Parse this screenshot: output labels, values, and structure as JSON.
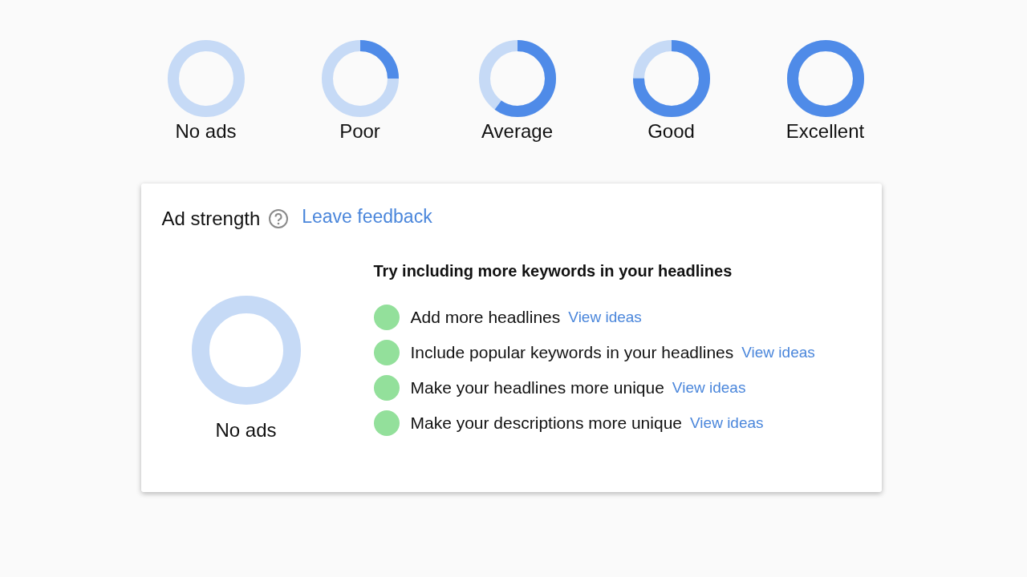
{
  "legend": [
    {
      "label": "No ads",
      "level": 0
    },
    {
      "label": "Poor",
      "level": 0.25
    },
    {
      "label": "Average",
      "level": 0.6
    },
    {
      "label": "Good",
      "level": 0.75
    },
    {
      "label": "Excellent",
      "level": 1
    }
  ],
  "card": {
    "title": "Ad strength",
    "feedback_link": "Leave feedback",
    "gauge": {
      "label": "No ads",
      "level": 0
    },
    "heading": "Try including more keywords in your headlines",
    "suggestions": [
      {
        "text": "Add more headlines",
        "link": "View ideas"
      },
      {
        "text": "Include popular keywords in your headlines",
        "link": "View ideas"
      },
      {
        "text": "Make your headlines more unique",
        "link": "View ideas"
      },
      {
        "text": "Make your descriptions more unique",
        "link": "View ideas"
      }
    ]
  }
}
